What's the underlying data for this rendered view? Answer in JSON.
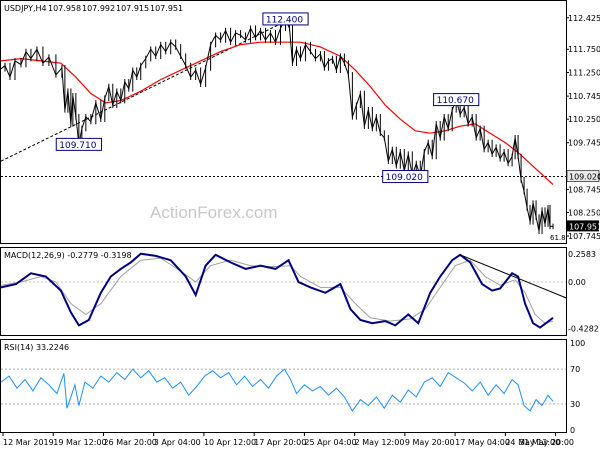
{
  "chart_data": [
    {
      "type": "candlestick",
      "header": {
        "symbol": "USDJPY,H4",
        "open": "107.958",
        "high": "107.992",
        "low": "107.915",
        "close": "107.951"
      },
      "ylim": [
        107.745,
        112.42
      ],
      "ytick_labels": [
        "112.425",
        "111.750",
        "111.250",
        "110.745",
        "110.250",
        "109.745",
        "109.020",
        "108.745",
        "108.250",
        "107.745"
      ],
      "price_path": [
        [
          0,
          111.33
        ],
        [
          4,
          111.4
        ],
        [
          9,
          111.15
        ],
        [
          14,
          111.5
        ],
        [
          20,
          111.42
        ],
        [
          25,
          111.7
        ],
        [
          30,
          111.55
        ],
        [
          36,
          111.75
        ],
        [
          42,
          111.45
        ],
        [
          48,
          111.58
        ],
        [
          55,
          111.2
        ],
        [
          61,
          111.35
        ],
        [
          64,
          110.45
        ],
        [
          67,
          110.85
        ],
        [
          70,
          110.15
        ],
        [
          72,
          110.75
        ],
        [
          75,
          110.3
        ],
        [
          78,
          109.71
        ],
        [
          81,
          110.05
        ],
        [
          85,
          110.3
        ],
        [
          90,
          110.2
        ],
        [
          95,
          110.6
        ],
        [
          100,
          110.25
        ],
        [
          104,
          110.7
        ],
        [
          108,
          110.95
        ],
        [
          112,
          110.55
        ],
        [
          116,
          110.85
        ],
        [
          120,
          110.65
        ],
        [
          124,
          111.05
        ],
        [
          128,
          110.9
        ],
        [
          132,
          111.3
        ],
        [
          136,
          111.15
        ],
        [
          140,
          111.4
        ],
        [
          145,
          111.55
        ],
        [
          150,
          111.75
        ],
        [
          155,
          111.6
        ],
        [
          160,
          111.85
        ],
        [
          165,
          111.7
        ],
        [
          170,
          111.9
        ],
        [
          175,
          111.8
        ],
        [
          180,
          111.6
        ],
        [
          185,
          111.4
        ],
        [
          190,
          111.15
        ],
        [
          195,
          111.3
        ],
        [
          200,
          111.0
        ],
        [
          205,
          111.35
        ],
        [
          210,
          111.85
        ],
        [
          215,
          112.05
        ],
        [
          220,
          111.95
        ],
        [
          225,
          112.15
        ],
        [
          230,
          111.9
        ],
        [
          235,
          112.1
        ],
        [
          240,
          112.05
        ],
        [
          245,
          111.95
        ],
        [
          250,
          112.2
        ],
        [
          255,
          112.0
        ],
        [
          260,
          112.15
        ],
        [
          265,
          111.95
        ],
        [
          270,
          112.1
        ],
        [
          275,
          111.9
        ],
        [
          280,
          112.2
        ],
        [
          285,
          112.4
        ],
        [
          289,
          112.2
        ],
        [
          292,
          111.45
        ],
        [
          296,
          111.75
        ],
        [
          300,
          111.55
        ],
        [
          305,
          111.85
        ],
        [
          310,
          111.7
        ],
        [
          315,
          111.55
        ],
        [
          320,
          111.65
        ],
        [
          324,
          111.35
        ],
        [
          328,
          111.5
        ],
        [
          332,
          111.55
        ],
        [
          336,
          111.3
        ],
        [
          340,
          111.6
        ],
        [
          344,
          111.45
        ],
        [
          348,
          111.2
        ],
        [
          352,
          110.3
        ],
        [
          356,
          110.55
        ],
        [
          360,
          110.8
        ],
        [
          364,
          110.1
        ],
        [
          368,
          110.45
        ],
        [
          372,
          110.05
        ],
        [
          376,
          110.3
        ],
        [
          380,
          109.95
        ],
        [
          384,
          109.85
        ],
        [
          388,
          109.35
        ],
        [
          392,
          109.6
        ],
        [
          396,
          109.25
        ],
        [
          400,
          109.55
        ],
        [
          404,
          109.15
        ],
        [
          408,
          109.5
        ],
        [
          412,
          109.05
        ],
        [
          416,
          109.3
        ],
        [
          420,
          109.02
        ],
        [
          424,
          109.55
        ],
        [
          428,
          109.75
        ],
        [
          432,
          109.45
        ],
        [
          436,
          110.15
        ],
        [
          440,
          109.85
        ],
        [
          444,
          110.3
        ],
        [
          448,
          110.05
        ],
        [
          452,
          110.45
        ],
        [
          456,
          110.67
        ],
        [
          460,
          110.35
        ],
        [
          464,
          110.5
        ],
        [
          468,
          110.15
        ],
        [
          472,
          110.3
        ],
        [
          476,
          109.85
        ],
        [
          480,
          110.05
        ],
        [
          484,
          109.6
        ],
        [
          488,
          109.75
        ],
        [
          492,
          109.5
        ],
        [
          496,
          109.65
        ],
        [
          500,
          109.4
        ],
        [
          504,
          109.55
        ],
        [
          508,
          109.3
        ],
        [
          512,
          109.45
        ],
        [
          515,
          109.85
        ],
        [
          518,
          109.45
        ],
        [
          521,
          108.95
        ],
        [
          524,
          108.7
        ],
        [
          527,
          108.35
        ],
        [
          530,
          108.05
        ],
        [
          533,
          108.45
        ],
        [
          536,
          108.15
        ],
        [
          539,
          107.85
        ],
        [
          542,
          108.3
        ],
        [
          545,
          108.0
        ],
        [
          548,
          108.35
        ],
        [
          550,
          107.95
        ],
        [
          553,
          107.951
        ]
      ],
      "ma_path": [
        [
          0,
          111.5
        ],
        [
          20,
          111.55
        ],
        [
          40,
          111.5
        ],
        [
          60,
          111.45
        ],
        [
          75,
          111.15
        ],
        [
          90,
          110.8
        ],
        [
          105,
          110.6
        ],
        [
          120,
          110.65
        ],
        [
          140,
          110.85
        ],
        [
          160,
          111.1
        ],
        [
          180,
          111.3
        ],
        [
          200,
          111.5
        ],
        [
          220,
          111.7
        ],
        [
          240,
          111.85
        ],
        [
          260,
          111.9
        ],
        [
          280,
          111.9
        ],
        [
          300,
          111.9
        ],
        [
          320,
          111.8
        ],
        [
          340,
          111.6
        ],
        [
          355,
          111.3
        ],
        [
          370,
          110.95
        ],
        [
          385,
          110.55
        ],
        [
          400,
          110.25
        ],
        [
          415,
          110.0
        ],
        [
          430,
          109.95
        ],
        [
          445,
          110.0
        ],
        [
          460,
          110.1
        ],
        [
          475,
          110.15
        ],
        [
          490,
          109.95
        ],
        [
          505,
          109.75
        ],
        [
          520,
          109.5
        ],
        [
          535,
          109.2
        ],
        [
          553,
          108.85
        ]
      ],
      "trendline": [
        [
          0,
          109.35
        ],
        [
          290,
          112.4
        ]
      ],
      "level_line": 109.02,
      "callouts": [
        {
          "label": "112.400",
          "i": 285,
          "price": 112.4
        },
        {
          "label": "110.670",
          "i": 456,
          "price": 110.67
        },
        {
          "label": "109.710",
          "i": 78,
          "price": 109.71
        },
        {
          "label": "109.020",
          "i": 405,
          "price": 109.02
        }
      ],
      "current_price": "107.951",
      "level_tag": "109.020",
      "fib_label": "61.8"
    },
    {
      "type": "line",
      "header": "MACD(12,26,9) -0.2779 -0.3198",
      "ylim": [
        -0.47,
        0.285
      ],
      "ytick_labels": [
        "0.2583",
        "0.00",
        "-0.4282"
      ],
      "macd": [
        [
          0,
          -0.05
        ],
        [
          15,
          -0.02
        ],
        [
          30,
          0.08
        ],
        [
          45,
          0.05
        ],
        [
          60,
          -0.08
        ],
        [
          70,
          -0.28
        ],
        [
          78,
          -0.4
        ],
        [
          88,
          -0.35
        ],
        [
          100,
          -0.1
        ],
        [
          110,
          0.05
        ],
        [
          120,
          0.12
        ],
        [
          130,
          0.18
        ],
        [
          140,
          0.26
        ],
        [
          155,
          0.24
        ],
        [
          170,
          0.2
        ],
        [
          185,
          0.05
        ],
        [
          195,
          -0.12
        ],
        [
          205,
          0.15
        ],
        [
          215,
          0.25
        ],
        [
          230,
          0.18
        ],
        [
          245,
          0.12
        ],
        [
          260,
          0.15
        ],
        [
          275,
          0.12
        ],
        [
          288,
          0.2
        ],
        [
          298,
          0.0
        ],
        [
          310,
          -0.05
        ],
        [
          325,
          -0.1
        ],
        [
          340,
          -0.02
        ],
        [
          350,
          -0.25
        ],
        [
          360,
          -0.35
        ],
        [
          372,
          -0.38
        ],
        [
          385,
          -0.36
        ],
        [
          395,
          -0.4
        ],
        [
          408,
          -0.3
        ],
        [
          418,
          -0.38
        ],
        [
          430,
          -0.1
        ],
        [
          440,
          0.05
        ],
        [
          452,
          0.2
        ],
        [
          460,
          0.25
        ],
        [
          470,
          0.18
        ],
        [
          482,
          -0.02
        ],
        [
          492,
          -0.08
        ],
        [
          500,
          -0.06
        ],
        [
          512,
          0.08
        ],
        [
          518,
          0.05
        ],
        [
          525,
          -0.2
        ],
        [
          533,
          -0.38
        ],
        [
          540,
          -0.42
        ],
        [
          546,
          -0.38
        ],
        [
          553,
          -0.33
        ]
      ],
      "signal": [
        [
          0,
          -0.03
        ],
        [
          20,
          0.0
        ],
        [
          40,
          0.05
        ],
        [
          55,
          0.0
        ],
        [
          70,
          -0.2
        ],
        [
          85,
          -0.3
        ],
        [
          100,
          -0.2
        ],
        [
          120,
          0.05
        ],
        [
          140,
          0.2
        ],
        [
          160,
          0.22
        ],
        [
          180,
          0.1
        ],
        [
          195,
          0.0
        ],
        [
          210,
          0.15
        ],
        [
          230,
          0.2
        ],
        [
          250,
          0.15
        ],
        [
          270,
          0.14
        ],
        [
          290,
          0.15
        ],
        [
          300,
          0.05
        ],
        [
          320,
          -0.05
        ],
        [
          340,
          -0.05
        ],
        [
          355,
          -0.2
        ],
        [
          370,
          -0.33
        ],
        [
          390,
          -0.36
        ],
        [
          410,
          -0.34
        ],
        [
          425,
          -0.25
        ],
        [
          440,
          -0.05
        ],
        [
          455,
          0.15
        ],
        [
          470,
          0.2
        ],
        [
          485,
          0.05
        ],
        [
          500,
          -0.03
        ],
        [
          515,
          0.02
        ],
        [
          525,
          -0.1
        ],
        [
          535,
          -0.3
        ],
        [
          545,
          -0.38
        ],
        [
          553,
          -0.36
        ]
      ],
      "trendline": [
        [
          460,
          0.25
        ],
        [
          567,
          -0.15
        ]
      ]
    },
    {
      "type": "line",
      "header": "RSI(14) 33.2246",
      "ylim": [
        0,
        100
      ],
      "ytick_labels": [
        "100",
        "70",
        "30",
        "0"
      ],
      "levels": [
        70,
        30
      ],
      "rsi": [
        [
          0,
          55
        ],
        [
          8,
          62
        ],
        [
          16,
          48
        ],
        [
          24,
          58
        ],
        [
          32,
          45
        ],
        [
          40,
          60
        ],
        [
          48,
          52
        ],
        [
          56,
          42
        ],
        [
          63,
          65
        ],
        [
          66,
          25
        ],
        [
          70,
          38
        ],
        [
          74,
          52
        ],
        [
          78,
          28
        ],
        [
          84,
          55
        ],
        [
          92,
          48
        ],
        [
          100,
          62
        ],
        [
          108,
          55
        ],
        [
          116,
          66
        ],
        [
          124,
          58
        ],
        [
          132,
          70
        ],
        [
          140,
          60
        ],
        [
          148,
          68
        ],
        [
          156,
          55
        ],
        [
          164,
          60
        ],
        [
          172,
          48
        ],
        [
          180,
          55
        ],
        [
          188,
          40
        ],
        [
          196,
          50
        ],
        [
          204,
          62
        ],
        [
          212,
          68
        ],
        [
          220,
          60
        ],
        [
          228,
          66
        ],
        [
          236,
          52
        ],
        [
          244,
          62
        ],
        [
          252,
          50
        ],
        [
          260,
          58
        ],
        [
          268,
          48
        ],
        [
          276,
          62
        ],
        [
          284,
          70
        ],
        [
          290,
          58
        ],
        [
          296,
          42
        ],
        [
          304,
          52
        ],
        [
          312,
          45
        ],
        [
          320,
          50
        ],
        [
          328,
          40
        ],
        [
          336,
          48
        ],
        [
          344,
          38
        ],
        [
          352,
          22
        ],
        [
          360,
          35
        ],
        [
          368,
          28
        ],
        [
          376,
          38
        ],
        [
          384,
          25
        ],
        [
          392,
          40
        ],
        [
          400,
          32
        ],
        [
          408,
          46
        ],
        [
          416,
          38
        ],
        [
          424,
          55
        ],
        [
          432,
          60
        ],
        [
          440,
          50
        ],
        [
          448,
          66
        ],
        [
          456,
          60
        ],
        [
          464,
          54
        ],
        [
          472,
          45
        ],
        [
          480,
          55
        ],
        [
          488,
          40
        ],
        [
          496,
          52
        ],
        [
          504,
          42
        ],
        [
          512,
          58
        ],
        [
          518,
          52
        ],
        [
          524,
          28
        ],
        [
          530,
          22
        ],
        [
          536,
          35
        ],
        [
          542,
          28
        ],
        [
          548,
          40
        ],
        [
          553,
          33
        ]
      ],
      "x_labels": [
        "12 Mar 2019",
        "19 Mar 12:00",
        "26 Mar 20:00",
        "3 Apr 04:00",
        "10 Apr 12:00",
        "17 Apr 20:00",
        "25 Apr 04:00",
        "2 May 12:00",
        "9 May 20:00",
        "17 May 04:00",
        "24 May 12:00",
        "31 May 20:00"
      ]
    }
  ],
  "watermark": "ActionForex.com",
  "colors": {
    "price": "#000000",
    "ma": "#ff0000",
    "macd": "#000080",
    "signal": "#a0a0a0",
    "rsi": "#1e90ff",
    "trendline": "#000000",
    "callout_border": "#000080",
    "price_tag_bg": "#000000"
  }
}
